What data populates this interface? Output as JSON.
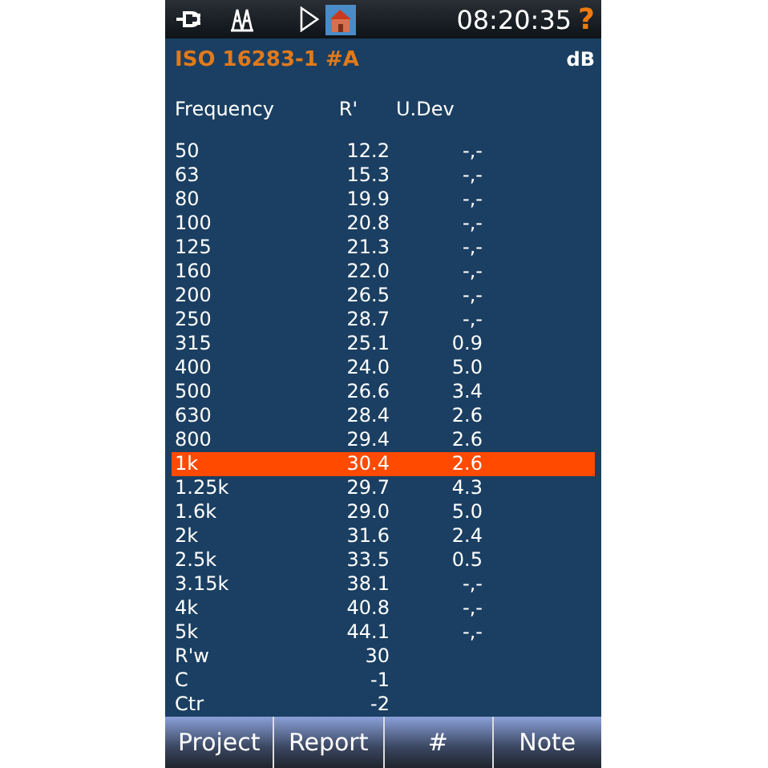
{
  "status_bar": {
    "time": "08:20:35",
    "help": "?"
  },
  "header": {
    "title": "ISO 16283-1 #A",
    "unit": "dB"
  },
  "table": {
    "columns": [
      "Frequency",
      "R'",
      "U.Dev"
    ],
    "rows": [
      {
        "freq": "50",
        "r": "12.2",
        "udev": "-,-",
        "selected": false
      },
      {
        "freq": "63",
        "r": "15.3",
        "udev": "-,-",
        "selected": false
      },
      {
        "freq": "80",
        "r": "19.9",
        "udev": "-,-",
        "selected": false
      },
      {
        "freq": "100",
        "r": "20.8",
        "udev": "-,-",
        "selected": false
      },
      {
        "freq": "125",
        "r": "21.3",
        "udev": "-,-",
        "selected": false
      },
      {
        "freq": "160",
        "r": "22.0",
        "udev": "-,-",
        "selected": false
      },
      {
        "freq": "200",
        "r": "26.5",
        "udev": "-,-",
        "selected": false
      },
      {
        "freq": "250",
        "r": "28.7",
        "udev": "-,-",
        "selected": false
      },
      {
        "freq": "315",
        "r": "25.1",
        "udev": "0.9",
        "selected": false
      },
      {
        "freq": "400",
        "r": "24.0",
        "udev": "5.0",
        "selected": false
      },
      {
        "freq": "500",
        "r": "26.6",
        "udev": "3.4",
        "selected": false
      },
      {
        "freq": "630",
        "r": "28.4",
        "udev": "2.6",
        "selected": false
      },
      {
        "freq": "800",
        "r": "29.4",
        "udev": "2.6",
        "selected": false
      },
      {
        "freq": "1k",
        "r": "30.4",
        "udev": "2.6",
        "selected": true
      },
      {
        "freq": "1.25k",
        "r": "29.7",
        "udev": "4.3",
        "selected": false
      },
      {
        "freq": "1.6k",
        "r": "29.0",
        "udev": "5.0",
        "selected": false
      },
      {
        "freq": "2k",
        "r": "31.6",
        "udev": "2.4",
        "selected": false
      },
      {
        "freq": "2.5k",
        "r": "33.5",
        "udev": "0.5",
        "selected": false
      },
      {
        "freq": "3.15k",
        "r": "38.1",
        "udev": "-,-",
        "selected": false
      },
      {
        "freq": "4k",
        "r": "40.8",
        "udev": "-,-",
        "selected": false
      },
      {
        "freq": "5k",
        "r": "44.1",
        "udev": "-,-",
        "selected": false
      },
      {
        "freq": "R'w",
        "r": "30",
        "selected": false
      },
      {
        "freq": "C",
        "r": "-1",
        "selected": false
      },
      {
        "freq": "Ctr",
        "r": "-2",
        "selected": false
      }
    ]
  },
  "buttons": [
    "Project",
    "Report",
    "#",
    "Note"
  ]
}
